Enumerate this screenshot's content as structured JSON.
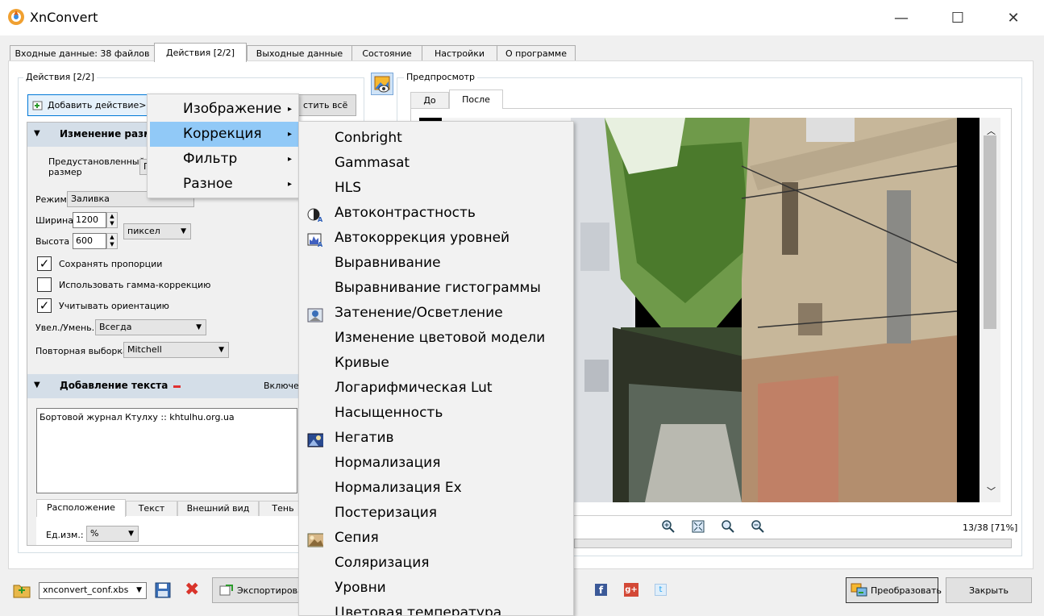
{
  "window": {
    "title": "XnConvert",
    "minimize": "—",
    "maximize": "☐",
    "close": "✕"
  },
  "tabs": [
    {
      "label": "Входные данные: 38 файлов"
    },
    {
      "label": "Действия [2/2]"
    },
    {
      "label": "Выходные данные"
    },
    {
      "label": "Состояние"
    },
    {
      "label": "Настройки"
    },
    {
      "label": "О программе"
    }
  ],
  "actions": {
    "group_title": "Действия [2/2]",
    "add_button": "Добавить действие>",
    "clear_button": "стить всё",
    "resize": {
      "header": "Изменение разме",
      "preset_label_1": "Предустановленный",
      "preset_label_2": "размер",
      "preset_value": "П",
      "mode_label": "Режим",
      "mode_value": "Заливка",
      "width_label": "Ширина",
      "width_value": "1200",
      "height_label": "Высота",
      "height_value": "600",
      "unit_value": "пиксел",
      "keep_ratio": "Сохранять пропорции",
      "gamma": "Использовать гамма-коррекцию",
      "orientation": "Учитывать ориентацию",
      "enlarge_label": "Увел./Умень.",
      "enlarge_value": "Всегда",
      "resample_label": "Повторная выборка",
      "resample_value": "Mitchell"
    },
    "text": {
      "header": "Добавление текста",
      "enabled_label": "Включен",
      "content": "Бортовой журнал Ктулху :: khtulhu.org.ua",
      "subtabs": [
        "Расположение",
        "Текст",
        "Внешний вид",
        "Тень"
      ],
      "unit_label": "Ед.изм.:",
      "unit_value": "%"
    }
  },
  "menu": {
    "items": [
      {
        "label": "Изображение",
        "submenu": "▸"
      },
      {
        "label": "Коррекция",
        "submenu": "▸"
      },
      {
        "label": "Фильтр",
        "submenu": "▸"
      },
      {
        "label": "Разное",
        "submenu": "▸"
      }
    ]
  },
  "submenu": {
    "items": [
      {
        "label": "Conbright"
      },
      {
        "label": "Gammasat"
      },
      {
        "label": "HLS"
      },
      {
        "label": "Автоконтрастность",
        "icon": "autocontrast-icon"
      },
      {
        "label": "Автокоррекция уровней",
        "icon": "autolevels-icon"
      },
      {
        "label": "Выравнивание"
      },
      {
        "label": "Выравнивание гистограммы"
      },
      {
        "label": "Затенение/Осветление",
        "icon": "shadow-highlight-icon"
      },
      {
        "label": "Изменение цветовой модели"
      },
      {
        "label": "Кривые"
      },
      {
        "label": "Логарифмическая Lut"
      },
      {
        "label": "Насыщенность"
      },
      {
        "label": "Негатив",
        "icon": "negative-icon"
      },
      {
        "label": "Нормализация"
      },
      {
        "label": "Нормализация Ex"
      },
      {
        "label": "Постеризация"
      },
      {
        "label": "Сепия",
        "icon": "sepia-icon"
      },
      {
        "label": "Соляризация"
      },
      {
        "label": "Уровни"
      },
      {
        "label": "Цветовая температура"
      }
    ]
  },
  "preview": {
    "group_title": "Предпросмотр",
    "tab_before": "До",
    "tab_after": "После",
    "page_info": "13/38 [71%]"
  },
  "footer": {
    "config_file": "xnconvert_conf.xbs",
    "export_button": "Экспортировать",
    "convert_button": "Преобразовать",
    "close_button": "Закрыть"
  },
  "colors": {
    "accent": "#91c9f7",
    "section": "#d4dee8",
    "close_red": "#d9342b"
  }
}
